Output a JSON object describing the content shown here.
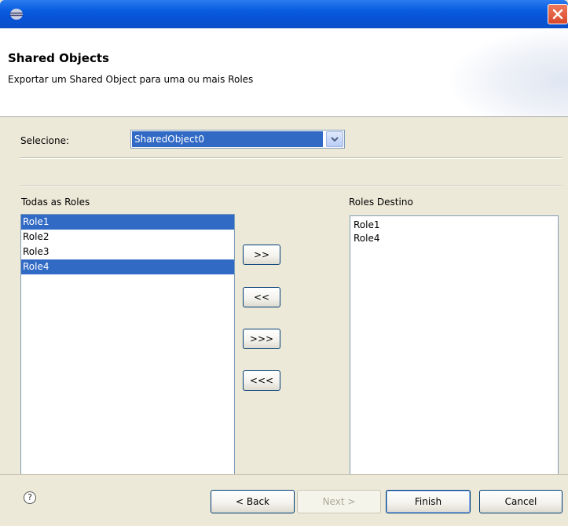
{
  "window": {
    "title": "",
    "icon": "eclipse-app-icon",
    "close_icon": "close-icon"
  },
  "header": {
    "title": "Shared Objects",
    "description": "Exportar um Shared Object para uma ou mais Roles"
  },
  "selector": {
    "label": "Selecione:",
    "value": "SharedObject0"
  },
  "left_list": {
    "label": "Todas as Roles",
    "items": [
      {
        "label": "Role1",
        "selected": true
      },
      {
        "label": "Role2",
        "selected": false
      },
      {
        "label": "Role3",
        "selected": false
      },
      {
        "label": "Role4",
        "selected": true
      }
    ]
  },
  "right_list": {
    "label": "Roles Destino",
    "items": [
      {
        "label": "Role1"
      },
      {
        "label": "Role4"
      }
    ]
  },
  "transfer_buttons": {
    "add": ">>",
    "remove": "<<",
    "add_all": ">>>",
    "remove_all": "<<<"
  },
  "footer": {
    "help_icon": "help-icon",
    "back": "< Back",
    "next": "Next >",
    "finish": "Finish",
    "cancel": "Cancel"
  },
  "colors": {
    "selection": "#316ac5",
    "titlebar": "#0a5ee0",
    "dialog_bg": "#ece9d8"
  }
}
